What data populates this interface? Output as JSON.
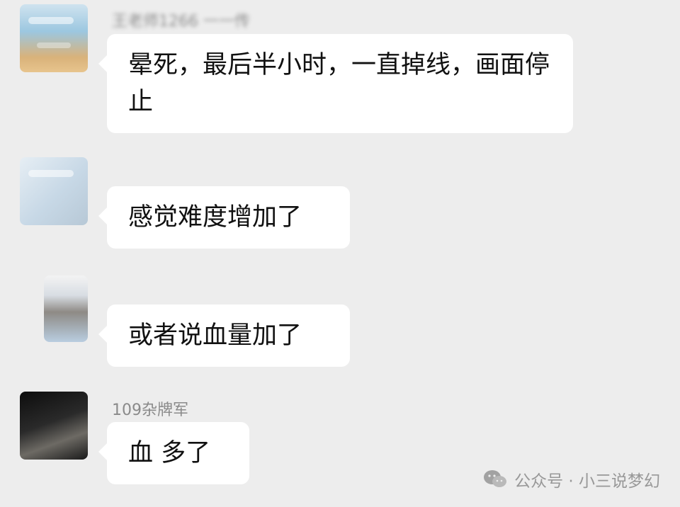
{
  "messages": [
    {
      "sender": "王老师1266 一一传",
      "text": "晕死，最后半小时，一直掉线，画面停止"
    },
    {
      "sender": "",
      "text": "感觉难度增加了"
    },
    {
      "sender": "",
      "text": "或者说血量加了"
    },
    {
      "sender": "109杂牌军",
      "text": "血  多了"
    }
  ],
  "watermark": {
    "text": "公众号 · 小三说梦幻",
    "icon": "wechat-icon"
  }
}
